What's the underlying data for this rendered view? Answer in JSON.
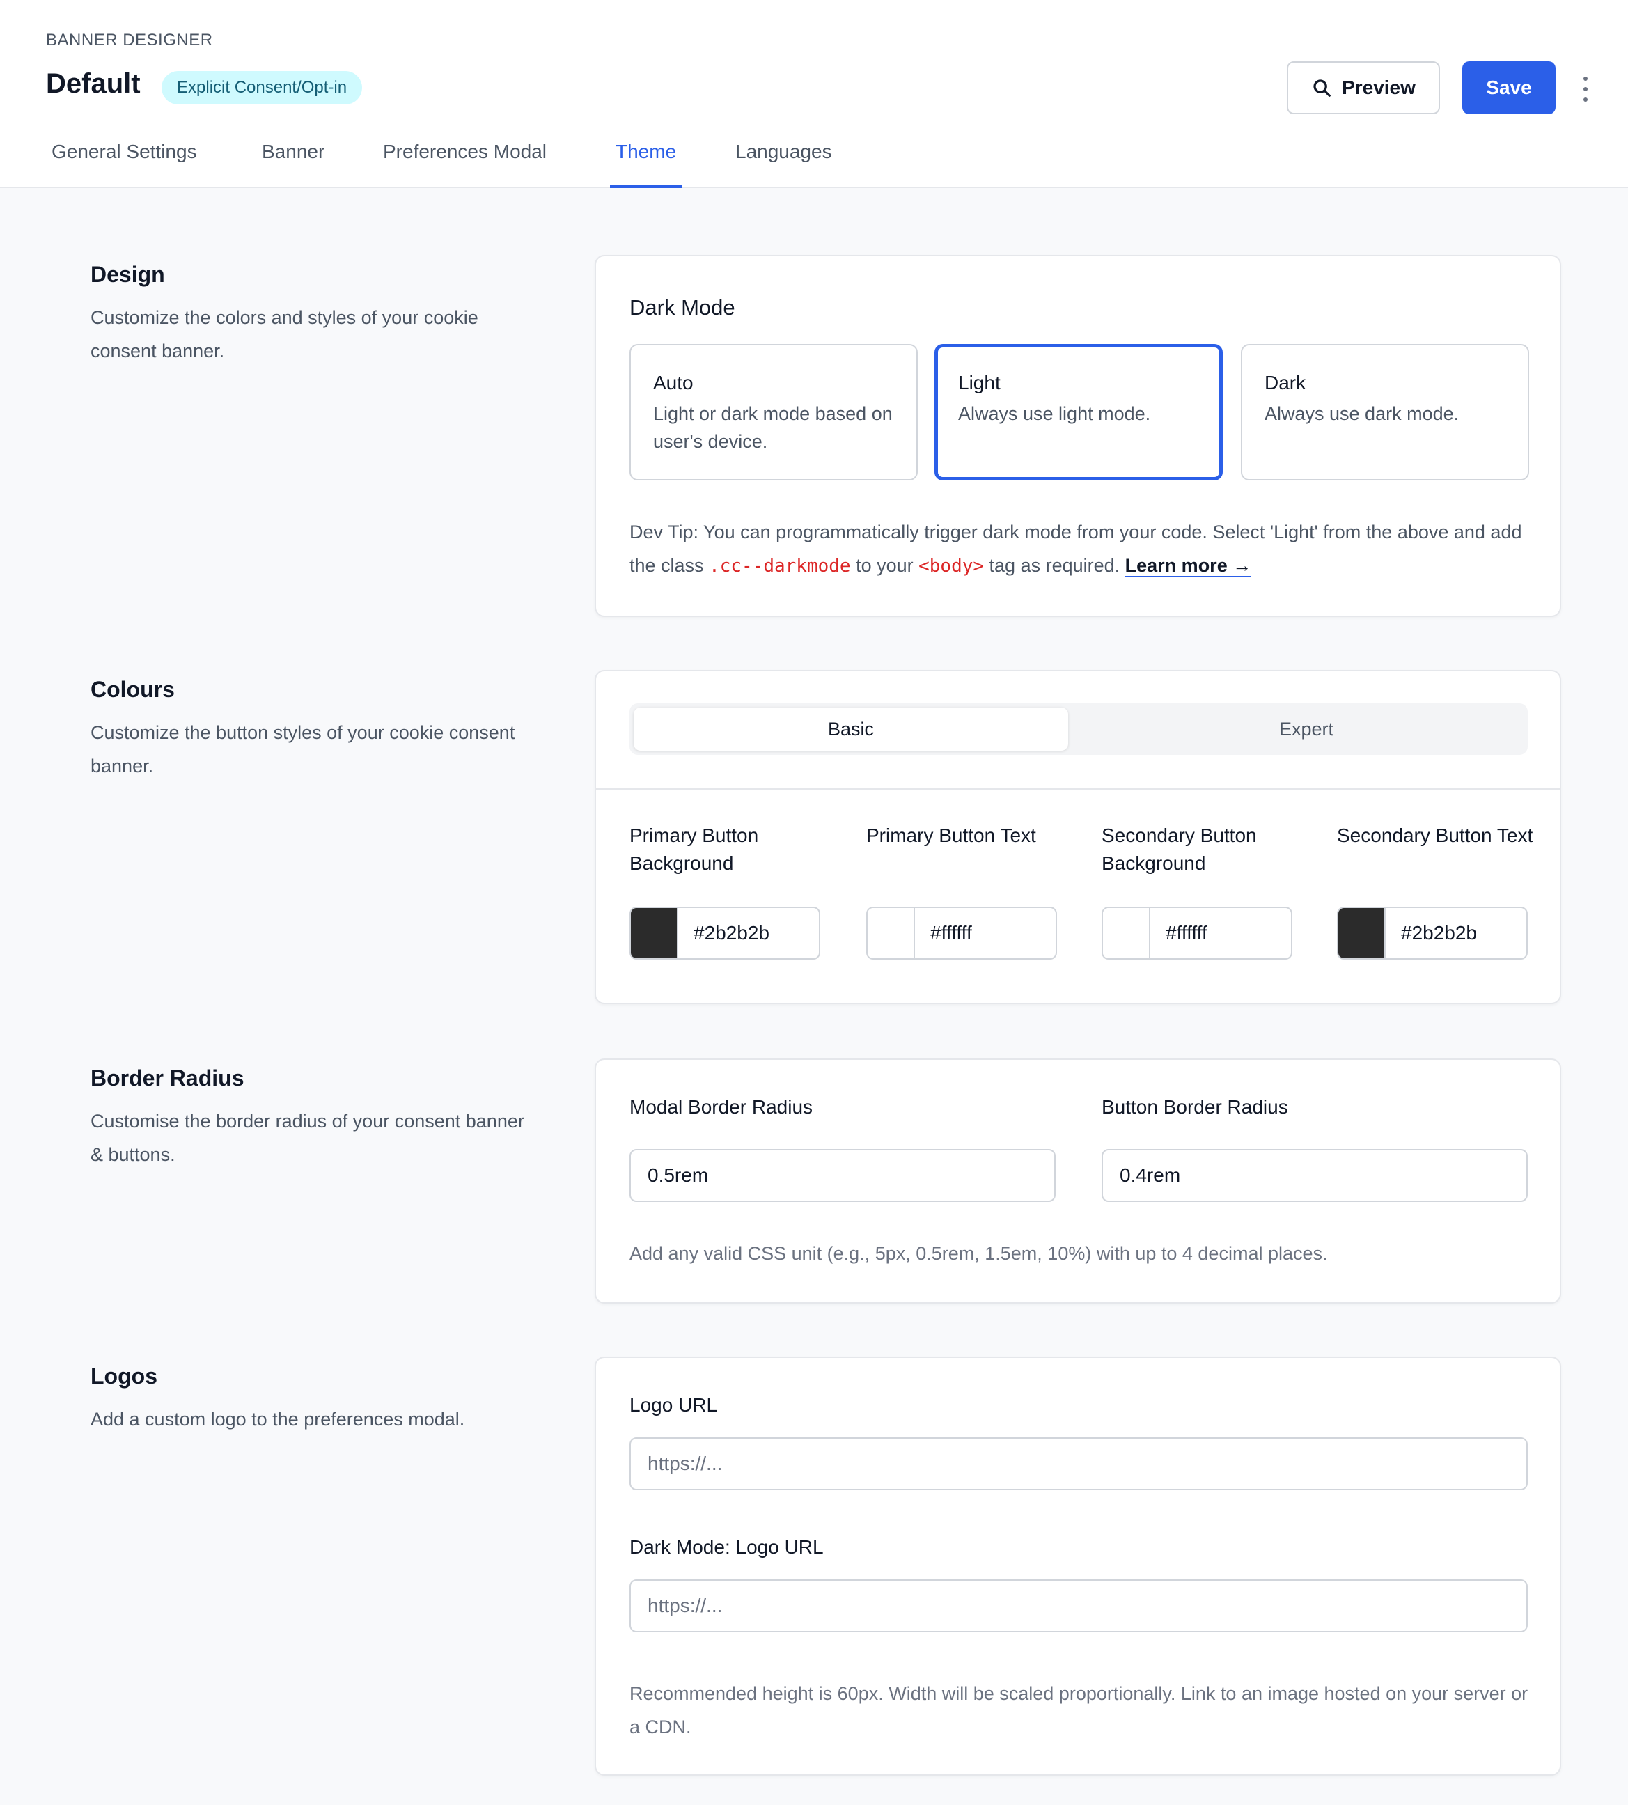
{
  "header": {
    "eyebrow": "BANNER DESIGNER",
    "title": "Default",
    "badge": "Explicit Consent/Opt-in",
    "preview_label": "Preview",
    "save_label": "Save"
  },
  "tabs": [
    {
      "label": "General Settings",
      "active": false
    },
    {
      "label": "Banner",
      "active": false
    },
    {
      "label": "Preferences Modal",
      "active": false
    },
    {
      "label": "Theme",
      "active": true
    },
    {
      "label": "Languages",
      "active": false
    }
  ],
  "design": {
    "title": "Design",
    "description": "Customize the colors and styles of your cookie consent banner.",
    "dark_mode": {
      "heading": "Dark Mode",
      "selected": "Light",
      "options": [
        {
          "name": "Auto",
          "description": "Light or dark mode based on user's device."
        },
        {
          "name": "Light",
          "description": "Always use light mode."
        },
        {
          "name": "Dark",
          "description": "Always use dark mode."
        }
      ],
      "tip_part1": "Dev Tip: You can programmatically trigger dark mode from your code. Select 'Light' from the above and add the class ",
      "tip_code1": ".cc--darkmode",
      "tip_part2": " to your ",
      "tip_code2": "<body>",
      "tip_part3": " tag as required. ",
      "learn_more": "Learn more →"
    }
  },
  "colours": {
    "title": "Colours",
    "description": "Customize the button styles of your cookie consent banner.",
    "modes": [
      "Basic",
      "Expert"
    ],
    "active_mode": "Basic",
    "fields": [
      {
        "label": "Primary Button Background",
        "value": "#2b2b2b",
        "color": "#2b2b2b"
      },
      {
        "label": "Primary Button Text",
        "value": "#ffffff",
        "color": "#ffffff"
      },
      {
        "label": "Secondary Button Background",
        "value": "#ffffff",
        "color": "#ffffff"
      },
      {
        "label": "Secondary Button Text",
        "value": "#2b2b2b",
        "color": "#2b2b2b"
      }
    ]
  },
  "border_radius": {
    "title": "Border Radius",
    "description": "Customise the border radius of your consent banner & buttons.",
    "modal_label": "Modal Border Radius",
    "modal_value": "0.5rem",
    "button_label": "Button Border Radius",
    "button_value": "0.4rem",
    "help": "Add any valid CSS unit (e.g., 5px, 0.5rem, 1.5em, 10%) with up to 4 decimal places."
  },
  "logos": {
    "title": "Logos",
    "description": "Add a custom logo to the preferences modal.",
    "logo_label": "Logo URL",
    "logo_placeholder": "https://...",
    "dark_logo_label": "Dark Mode: Logo URL",
    "dark_logo_placeholder": "https://...",
    "help": "Recommended height is 60px. Width will be scaled proportionally. Link to an image hosted on your server or a CDN."
  },
  "colors": {
    "accent": "#2b5fe8",
    "badge_bg": "#cffafe",
    "code": "#dc2626"
  }
}
